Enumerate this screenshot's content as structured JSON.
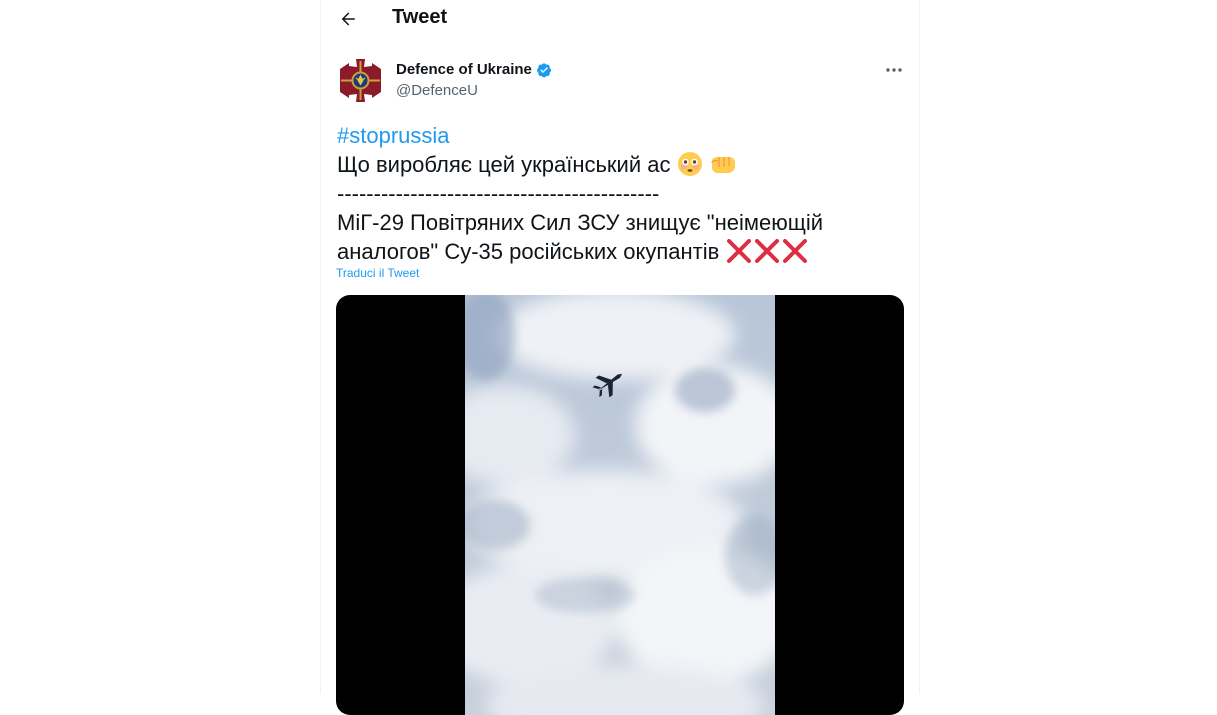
{
  "header": {
    "title": "Tweet",
    "back_icon": "arrow-left-icon"
  },
  "tweet": {
    "author": {
      "name": "Defence of Ukraine",
      "handle": "@DefenceU",
      "verified": true,
      "avatar_icon": "ukraine-defence-emblem-icon"
    },
    "more_icon": "more-horizontal-icon",
    "hashtag": "#stopruss‌ia",
    "line1": "Що виробляє цей український ас",
    "line1_emojis": [
      "flushed-face-emoji",
      "fist-emoji"
    ],
    "divider": "--------------------------------------------",
    "line3": "МіГ-29 Повітряних Сил ЗСУ знищує \"неімеющій",
    "line4": "аналогов\" Су-35 російських окупантів",
    "line4_emojis": [
      "cross-mark-emoji",
      "cross-mark-emoji",
      "cross-mark-emoji"
    ],
    "translate_link": "Traduci il Tweet",
    "media": {
      "type": "video",
      "subject": "fighter-jet-in-cloudy-sky"
    }
  },
  "colors": {
    "accent": "#1d9bf0",
    "text": "#0f1419",
    "secondary_text": "#536471",
    "emblem_red": "#8b1a2b",
    "emblem_gold": "#c9a23a"
  }
}
